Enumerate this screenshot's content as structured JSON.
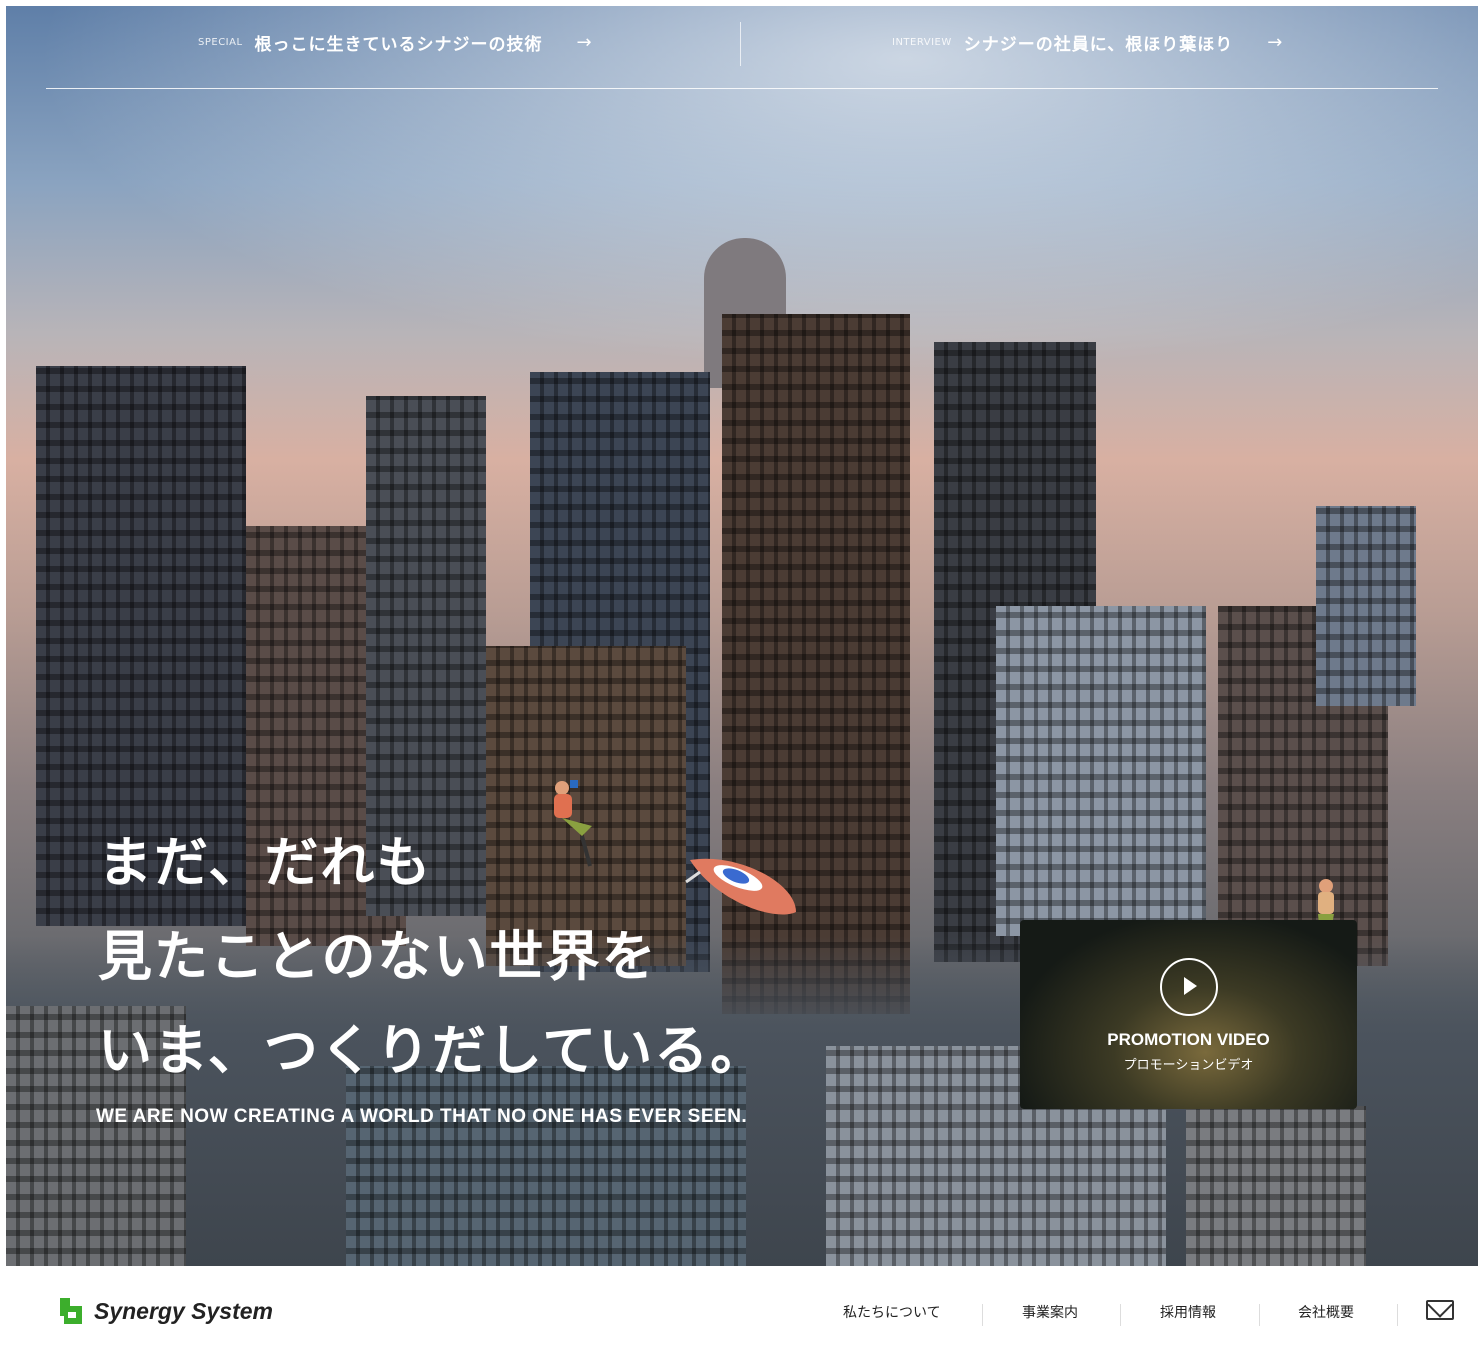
{
  "topnav": {
    "items": [
      {
        "tag": "SPECIAL",
        "title": "根っこに生きているシナジーの技術",
        "arrow": "→"
      },
      {
        "tag": "INTERVIEW",
        "title": "シナジーの社員に、根ほり葉ほり",
        "arrow": "→"
      }
    ]
  },
  "hero": {
    "headline": [
      "まだ、だれも",
      "見たことのない世界を",
      "いま、つくりだしている。"
    ],
    "subline": "WE ARE NOW CREATING A WORLD THAT NO ONE HAS EVER SEEN."
  },
  "promo": {
    "title": "PROMOTION VIDEO",
    "subtitle": "プロモーションビデオ",
    "icon": "play-icon"
  },
  "footer": {
    "logo_text": "Synergy System",
    "logo_color": "#3cae2c",
    "menu": [
      "私たちについて",
      "事業案内",
      "採用情報",
      "会社概要"
    ],
    "mail_icon": "mail-icon"
  }
}
